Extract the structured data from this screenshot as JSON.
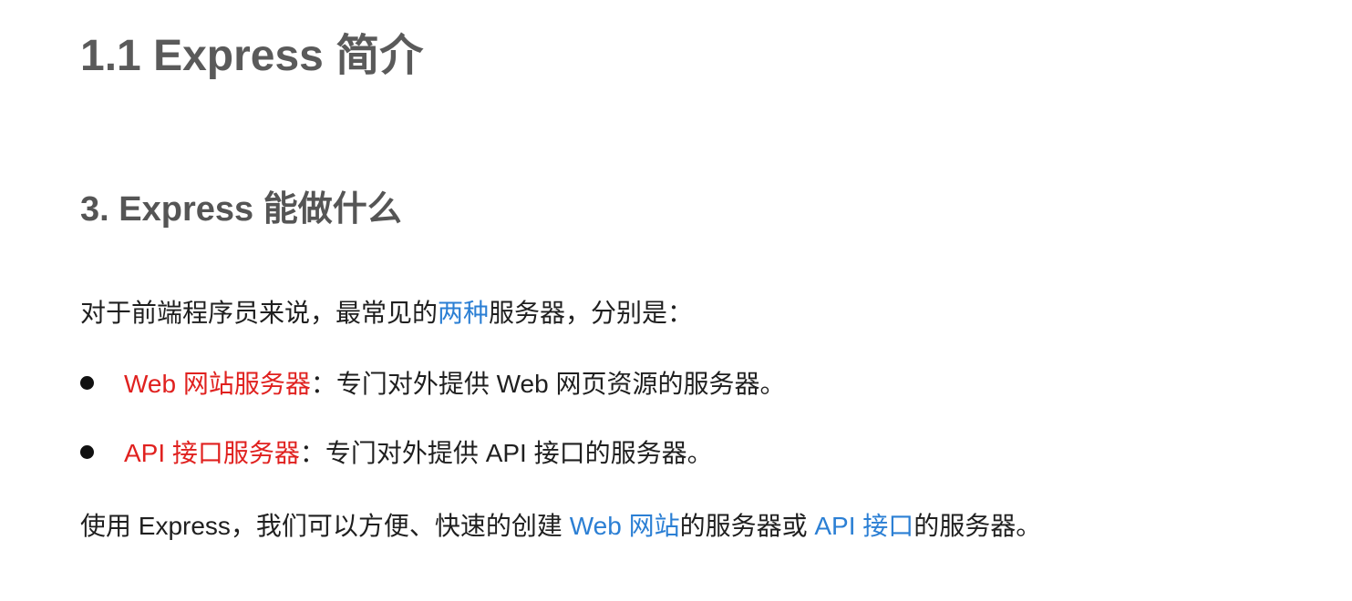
{
  "heading_main": "1.1 Express 简介",
  "heading_sub": "3. Express 能做什么",
  "intro": {
    "before": "对于前端程序员来说，最常见的",
    "highlight": "两种",
    "after": "服务器，分别是："
  },
  "bullets": [
    {
      "term": "Web 网站服务器",
      "desc": "：专门对外提供 Web 网页资源的服务器。"
    },
    {
      "term": "API 接口服务器",
      "desc": "：专门对外提供 API 接口的服务器。"
    }
  ],
  "summary": {
    "part1": "使用 Express，我们可以方便、快速的创建 ",
    "link1": "Web 网站",
    "part2": "的服务器或 ",
    "link2": "API 接口",
    "part3": "的服务器。"
  },
  "colors": {
    "highlight_blue": "#2b7fd4",
    "term_red": "#e0211f",
    "heading_gray": "#5a5a5a"
  }
}
